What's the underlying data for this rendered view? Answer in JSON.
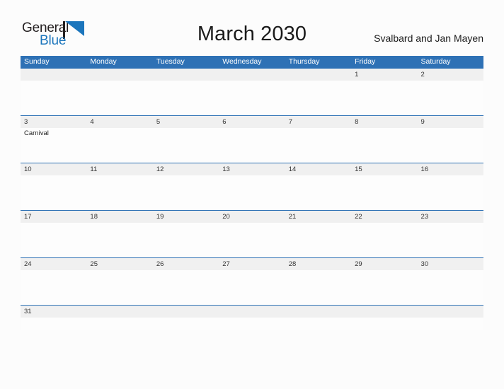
{
  "brand": {
    "name_part1": "General",
    "name_part2": "Blue",
    "color_dark": "#231f20",
    "color_blue": "#1b75bc"
  },
  "header": {
    "title": "March 2030",
    "region": "Svalbard and Jan Mayen"
  },
  "theme": {
    "header_blue": "#2e71b5",
    "row_line_blue": "#2e71b5",
    "daynum_band": "#f0f0f0",
    "page_background": "#fcfcfc"
  },
  "calendar": {
    "weekdays": [
      "Sunday",
      "Monday",
      "Tuesday",
      "Wednesday",
      "Thursday",
      "Friday",
      "Saturday"
    ],
    "weeks": [
      {
        "days": [
          {
            "num": "",
            "event": ""
          },
          {
            "num": "",
            "event": ""
          },
          {
            "num": "",
            "event": ""
          },
          {
            "num": "",
            "event": ""
          },
          {
            "num": "",
            "event": ""
          },
          {
            "num": "1",
            "event": ""
          },
          {
            "num": "2",
            "event": ""
          }
        ]
      },
      {
        "days": [
          {
            "num": "3",
            "event": "Carnival"
          },
          {
            "num": "4",
            "event": ""
          },
          {
            "num": "5",
            "event": ""
          },
          {
            "num": "6",
            "event": ""
          },
          {
            "num": "7",
            "event": ""
          },
          {
            "num": "8",
            "event": ""
          },
          {
            "num": "9",
            "event": ""
          }
        ]
      },
      {
        "days": [
          {
            "num": "10",
            "event": ""
          },
          {
            "num": "11",
            "event": ""
          },
          {
            "num": "12",
            "event": ""
          },
          {
            "num": "13",
            "event": ""
          },
          {
            "num": "14",
            "event": ""
          },
          {
            "num": "15",
            "event": ""
          },
          {
            "num": "16",
            "event": ""
          }
        ]
      },
      {
        "days": [
          {
            "num": "17",
            "event": ""
          },
          {
            "num": "18",
            "event": ""
          },
          {
            "num": "19",
            "event": ""
          },
          {
            "num": "20",
            "event": ""
          },
          {
            "num": "21",
            "event": ""
          },
          {
            "num": "22",
            "event": ""
          },
          {
            "num": "23",
            "event": ""
          }
        ]
      },
      {
        "days": [
          {
            "num": "24",
            "event": ""
          },
          {
            "num": "25",
            "event": ""
          },
          {
            "num": "26",
            "event": ""
          },
          {
            "num": "27",
            "event": ""
          },
          {
            "num": "28",
            "event": ""
          },
          {
            "num": "29",
            "event": ""
          },
          {
            "num": "30",
            "event": ""
          }
        ]
      },
      {
        "short": true,
        "days": [
          {
            "num": "31",
            "event": ""
          },
          {
            "num": "",
            "event": ""
          },
          {
            "num": "",
            "event": ""
          },
          {
            "num": "",
            "event": ""
          },
          {
            "num": "",
            "event": ""
          },
          {
            "num": "",
            "event": ""
          },
          {
            "num": "",
            "event": ""
          }
        ]
      }
    ]
  }
}
